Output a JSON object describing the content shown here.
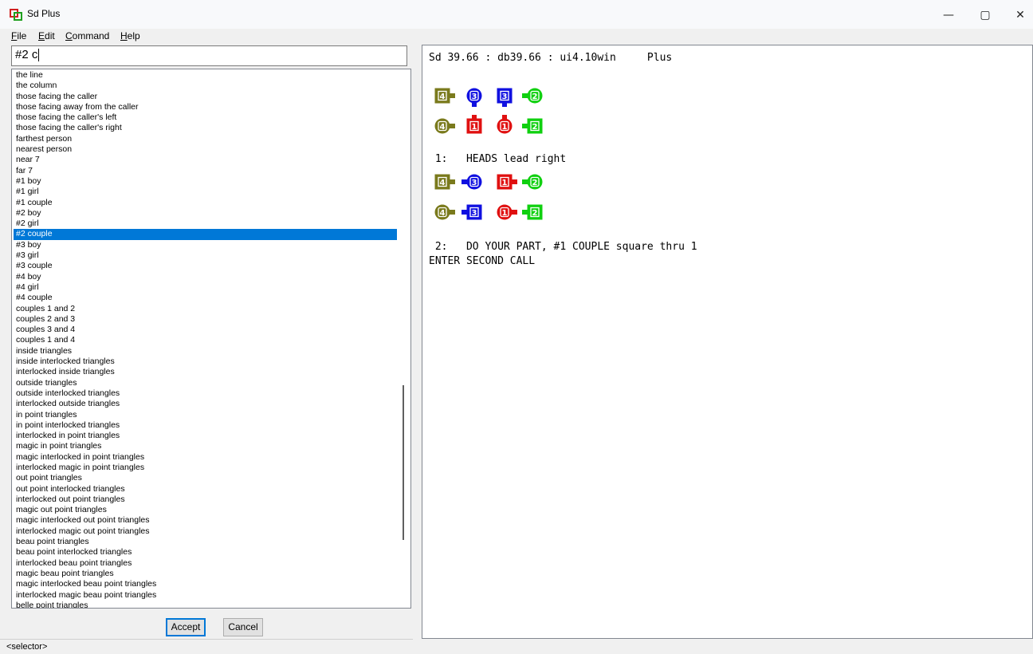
{
  "window": {
    "title": "Sd Plus",
    "controls": [
      "—",
      "▢",
      "✕"
    ]
  },
  "menu": [
    {
      "label": "File",
      "u": "F"
    },
    {
      "label": "Edit",
      "u": "E"
    },
    {
      "label": "Command",
      "u": "C"
    },
    {
      "label": "Help",
      "u": "H"
    }
  ],
  "input": {
    "value": "#2 c"
  },
  "list": {
    "selected_index": 15,
    "items": [
      "the line",
      "the column",
      "those facing the caller",
      "those facing away from the caller",
      "those facing the caller's left",
      "those facing the caller's right",
      "farthest person",
      "nearest person",
      "near 7",
      "far 7",
      "#1 boy",
      "#1 girl",
      "#1 couple",
      "#2 boy",
      "#2 girl",
      "#2 couple",
      "#3 boy",
      "#3 girl",
      "#3 couple",
      "#4 boy",
      "#4 girl",
      "#4 couple",
      "couples 1 and 2",
      "couples 2 and 3",
      "couples 3 and 4",
      "couples 1 and 4",
      "inside triangles",
      "inside interlocked triangles",
      "interlocked inside triangles",
      "outside triangles",
      "outside interlocked triangles",
      "interlocked outside triangles",
      "in point triangles",
      "in point interlocked triangles",
      "interlocked in point triangles",
      "magic in point triangles",
      "magic interlocked in point triangles",
      "interlocked magic in point triangles",
      "out point triangles",
      "out point interlocked triangles",
      "interlocked out point triangles",
      "magic out point triangles",
      "magic interlocked out point triangles",
      "interlocked magic out point triangles",
      "beau point triangles",
      "beau point interlocked triangles",
      "interlocked beau point triangles",
      "magic beau point triangles",
      "magic interlocked beau point triangles",
      "interlocked magic beau point triangles",
      "belle point triangles"
    ]
  },
  "buttons": {
    "accept": "Accept",
    "cancel": "Cancel"
  },
  "status": {
    "text": "<selector>"
  },
  "output": {
    "header": "Sd 39.66 : db39.66 : ui4.10win     Plus",
    "call1": " 1:   HEADS lead right",
    "call2": " 2:   DO YOUR PART, #1 COUPLE square thru 1",
    "prompt": "ENTER SECOND CALL",
    "formations": [
      [
        [
          {
            "n": "4",
            "shape": "square",
            "dir": "right",
            "color": "#7a7a1c"
          },
          {
            "n": "3",
            "shape": "circle",
            "dir": "down",
            "color": "#1010e0"
          },
          {
            "n": "3",
            "shape": "square",
            "dir": "down",
            "color": "#1010e0"
          },
          {
            "n": "2",
            "shape": "circle",
            "dir": "left",
            "color": "#10d010"
          }
        ],
        [
          {
            "n": "4",
            "shape": "circle",
            "dir": "right",
            "color": "#7a7a1c"
          },
          {
            "n": "1",
            "shape": "square",
            "dir": "up",
            "color": "#e01010"
          },
          {
            "n": "1",
            "shape": "circle",
            "dir": "up",
            "color": "#e01010"
          },
          {
            "n": "2",
            "shape": "square",
            "dir": "left",
            "color": "#10d010"
          }
        ]
      ],
      [
        [
          {
            "n": "4",
            "shape": "square",
            "dir": "right",
            "color": "#7a7a1c"
          },
          {
            "n": "3",
            "shape": "circle",
            "dir": "left",
            "color": "#1010e0"
          },
          {
            "n": "1",
            "shape": "square",
            "dir": "right",
            "color": "#e01010"
          },
          {
            "n": "2",
            "shape": "circle",
            "dir": "left",
            "color": "#10d010"
          }
        ],
        [
          {
            "n": "4",
            "shape": "circle",
            "dir": "right",
            "color": "#7a7a1c"
          },
          {
            "n": "3",
            "shape": "square",
            "dir": "left",
            "color": "#1010e0"
          },
          {
            "n": "1",
            "shape": "circle",
            "dir": "right",
            "color": "#e01010"
          },
          {
            "n": "2",
            "shape": "square",
            "dir": "left",
            "color": "#10d010"
          }
        ]
      ]
    ]
  }
}
